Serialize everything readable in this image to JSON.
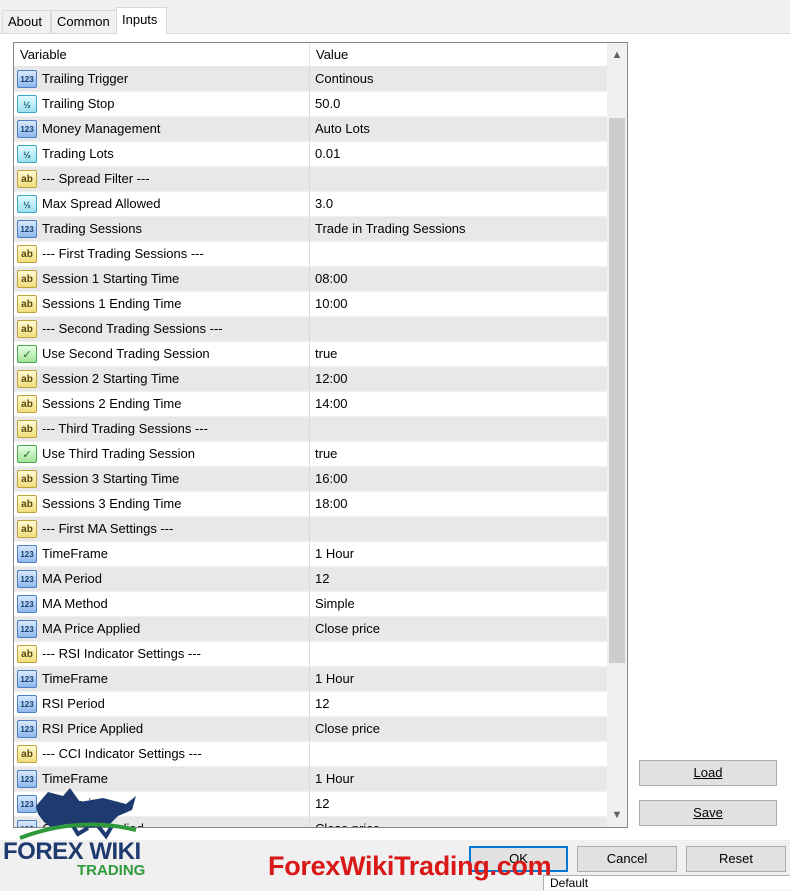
{
  "tabs": [
    {
      "label": "About",
      "active": false
    },
    {
      "label": "Common",
      "active": false
    },
    {
      "label": "Inputs",
      "active": true
    }
  ],
  "grid": {
    "headers": {
      "variable": "Variable",
      "value": "Value"
    },
    "rows": [
      {
        "type": "int",
        "icon": "123",
        "name": "Trailing Trigger",
        "value": "Continous"
      },
      {
        "type": "double",
        "icon": "½",
        "name": "Trailing Stop",
        "value": "50.0"
      },
      {
        "type": "int",
        "icon": "123",
        "name": "Money Management",
        "value": "Auto Lots"
      },
      {
        "type": "double",
        "icon": "½",
        "name": "Trading Lots",
        "value": "0.01"
      },
      {
        "type": "string",
        "icon": "ab",
        "name": "--- Spread Filter ---",
        "value": ""
      },
      {
        "type": "double",
        "icon": "½",
        "name": "Max Spread Allowed",
        "value": "3.0"
      },
      {
        "type": "int",
        "icon": "123",
        "name": "Trading Sessions",
        "value": "Trade in Trading Sessions"
      },
      {
        "type": "string",
        "icon": "ab",
        "name": "--- First Trading Sessions ---",
        "value": ""
      },
      {
        "type": "string",
        "icon": "ab",
        "name": "Session 1 Starting Time",
        "value": "08:00"
      },
      {
        "type": "string",
        "icon": "ab",
        "name": "Sessions 1 Ending Time",
        "value": "10:00"
      },
      {
        "type": "string",
        "icon": "ab",
        "name": "--- Second Trading Sessions ---",
        "value": ""
      },
      {
        "type": "bool",
        "icon": "✓",
        "name": "Use Second Trading Session",
        "value": "true"
      },
      {
        "type": "string",
        "icon": "ab",
        "name": "Session 2 Starting Time",
        "value": "12:00"
      },
      {
        "type": "string",
        "icon": "ab",
        "name": "Sessions 2 Ending Time",
        "value": "14:00"
      },
      {
        "type": "string",
        "icon": "ab",
        "name": "--- Third Trading Sessions ---",
        "value": ""
      },
      {
        "type": "bool",
        "icon": "✓",
        "name": "Use Third Trading Session",
        "value": "true"
      },
      {
        "type": "string",
        "icon": "ab",
        "name": "Session 3 Starting Time",
        "value": "16:00"
      },
      {
        "type": "string",
        "icon": "ab",
        "name": "Sessions 3 Ending Time",
        "value": "18:00"
      },
      {
        "type": "string",
        "icon": "ab",
        "name": "--- First MA Settings ---",
        "value": ""
      },
      {
        "type": "int",
        "icon": "123",
        "name": "TimeFrame",
        "value": "1 Hour"
      },
      {
        "type": "int",
        "icon": "123",
        "name": "MA Period",
        "value": "12"
      },
      {
        "type": "int",
        "icon": "123",
        "name": "MA Method",
        "value": "Simple"
      },
      {
        "type": "int",
        "icon": "123",
        "name": "MA Price Applied",
        "value": "Close price"
      },
      {
        "type": "string",
        "icon": "ab",
        "name": "--- RSI Indicator Settings ---",
        "value": ""
      },
      {
        "type": "int",
        "icon": "123",
        "name": "TimeFrame",
        "value": "1 Hour"
      },
      {
        "type": "int",
        "icon": "123",
        "name": "RSI Period",
        "value": "12"
      },
      {
        "type": "int",
        "icon": "123",
        "name": "RSI Price Applied",
        "value": "Close price"
      },
      {
        "type": "string",
        "icon": "ab",
        "name": "--- CCI Indicator Settings ---",
        "value": ""
      },
      {
        "type": "int",
        "icon": "123",
        "name": "TimeFrame",
        "value": "1 Hour"
      },
      {
        "type": "int",
        "icon": "123",
        "name": "CCI Period",
        "value": "12"
      },
      {
        "type": "int",
        "icon": "123",
        "name": "CCI Price Applied",
        "value": "Close price"
      }
    ]
  },
  "buttons": {
    "load": "Load",
    "save": "Save",
    "ok": "OK",
    "cancel": "Cancel",
    "reset": "Reset"
  },
  "behind_window_text": "Default",
  "watermark": {
    "site": "ForexWikiTrading.com",
    "logo_main": "FOREX WIKI",
    "logo_sub": "TRADING"
  },
  "colors": {
    "grid_alt_row": "#e8e8e8",
    "default_button_border": "#0078d7",
    "watermark_red": "#d91818",
    "logo_blue": "#1e3a6e",
    "logo_green": "#2f9a3b"
  }
}
